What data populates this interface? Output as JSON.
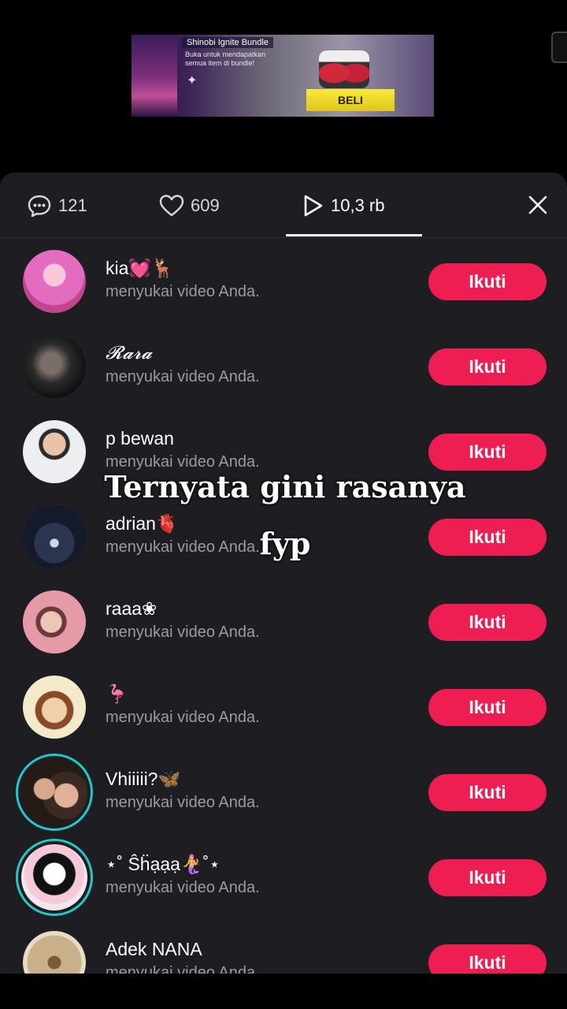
{
  "banner": {
    "title": "Shinobi Ignite Bundle",
    "description": "Buka untuk mendapatkan semua item di bundle!",
    "buy_label": "BELI"
  },
  "tabs": {
    "comments_count": "121",
    "likes_count": "609",
    "views_count": "10,3 rb",
    "active": "views"
  },
  "rows": [
    {
      "name": "kia💓🦌",
      "subtitle": "menyukai video Anda.",
      "button": "Ikuti",
      "avatar_color": "#e36cc0"
    },
    {
      "name": "𝓡𝓪𝓻𝓪",
      "subtitle": "menyukai video Anda.",
      "button": "Ikuti",
      "avatar_color": "#3a3a3a"
    },
    {
      "name": "p bewan",
      "subtitle": "menyukai video Anda.",
      "button": "Ikuti",
      "avatar_color": "#cfd3d8"
    },
    {
      "name": "adrian🫀",
      "subtitle": "menyukai video Anda.",
      "button": "Ikuti",
      "avatar_color": "#1c2438"
    },
    {
      "name": "raaa❀",
      "subtitle": "menyukai video Anda.",
      "button": "Ikuti",
      "avatar_color": "#e59aa8"
    },
    {
      "name": "🦩",
      "subtitle": "menyukai video Anda.",
      "button": "Ikuti",
      "avatar_color": "#f2eac8"
    },
    {
      "name": "Vhiiiii?🦋",
      "subtitle": "menyukai video Anda.",
      "button": "Ikuti",
      "avatar_color": "#4a3a30"
    },
    {
      "name": "⋆˚ Ŝḧạạạ🧜‍♀️˚⋆",
      "subtitle": "menyukai video Anda.",
      "button": "Ikuti",
      "avatar_color": "#f1e8ee"
    },
    {
      "name": "Adek NANA",
      "subtitle": "menyukai video Anda.",
      "button": "Ikuti",
      "avatar_color": "#c9b08a"
    }
  ],
  "overlay": {
    "line1": "Ternyata gini rasanya",
    "line2": "fyp"
  },
  "colors": {
    "accent": "#ee1d52",
    "sheet_bg": "#1e1e22",
    "story_ring": "#26c6c6"
  }
}
